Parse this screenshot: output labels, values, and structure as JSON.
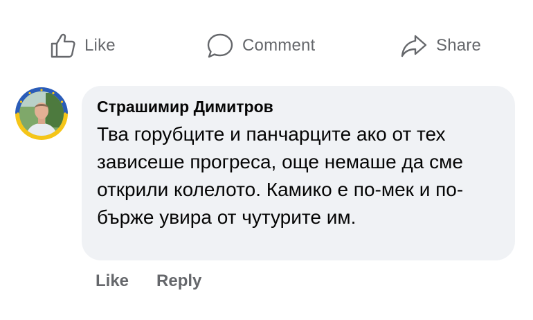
{
  "actions": {
    "like_label": "Like",
    "comment_label": "Comment",
    "share_label": "Share"
  },
  "comment": {
    "author": "Страшимир Димитров",
    "text": "Тва горубците и панчарците ако от тех зависеше прогреса, още немаше да сме открили колелото. Камико е по-мек и по-бърже увира от чутурите им.",
    "like_label": "Like",
    "reply_label": "Reply"
  },
  "colors": {
    "muted_text": "#65676b",
    "bubble_bg": "#f0f2f5",
    "avatar_ring_blue": "#2a5cb8",
    "avatar_ring_yellow": "#f5c518"
  },
  "icons": {
    "like": "thumbs-up-icon",
    "comment": "speech-bubble-icon",
    "share": "share-arrow-icon"
  }
}
